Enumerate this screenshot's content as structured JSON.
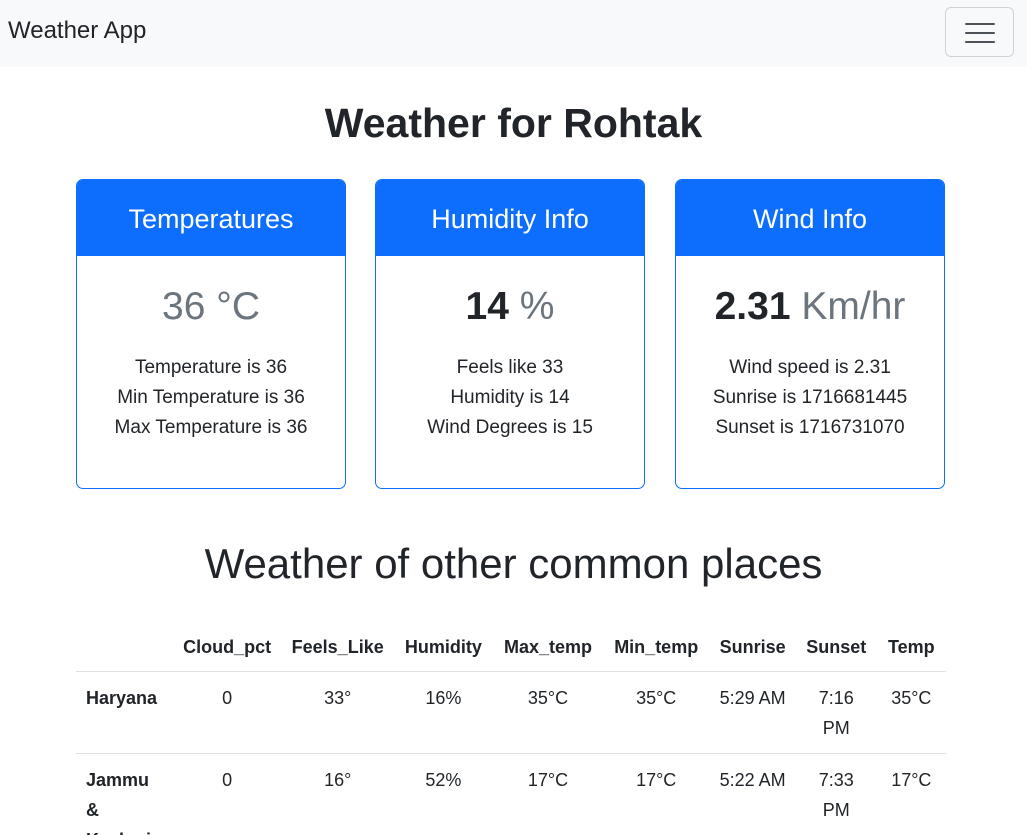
{
  "navbar": {
    "brand": "Weather App",
    "toggler_icon": "hamburger-menu-icon"
  },
  "heading": "Weather for Rohtak",
  "cards": {
    "temperature": {
      "title": "Temperatures",
      "value": "36",
      "unit": "°C",
      "lines": [
        "Temperature is 36",
        "Min Temperature is 36",
        "Max Temperature is 36"
      ]
    },
    "humidity": {
      "title": "Humidity Info",
      "value": "14",
      "unit": "%",
      "lines": [
        "Feels like 33",
        "Humidity is 14",
        "Wind Degrees is 15"
      ]
    },
    "wind": {
      "title": "Wind Info",
      "value": "2.31",
      "unit": "Km/hr",
      "lines": [
        "Wind speed is 2.31",
        "Sunrise is 1716681445",
        "Sunset is 1716731070"
      ]
    }
  },
  "common_places": {
    "heading": "Weather of other common places",
    "columns": [
      "",
      "Cloud_pct",
      "Feels_Like",
      "Humidity",
      "Max_temp",
      "Min_temp",
      "Sunrise",
      "Sunset",
      "Temp"
    ],
    "rows": [
      {
        "place": "Haryana",
        "cloud_pct": "0",
        "feels_like": "33°",
        "humidity": "16%",
        "max_temp": "35°C",
        "min_temp": "35°C",
        "sunrise": "5:29 AM",
        "sunset": "7:16 PM",
        "temp": "35°C"
      },
      {
        "place": "Jammu & Kashmir",
        "cloud_pct": "0",
        "feels_like": "16°",
        "humidity": "52%",
        "max_temp": "17°C",
        "min_temp": "17°C",
        "sunrise": "5:22 AM",
        "sunset": "7:33 PM",
        "temp": "17°C"
      }
    ]
  },
  "colors": {
    "primary": "#0d6efd",
    "navbar_bg": "#f8f9fa",
    "muted": "#6c757d"
  }
}
